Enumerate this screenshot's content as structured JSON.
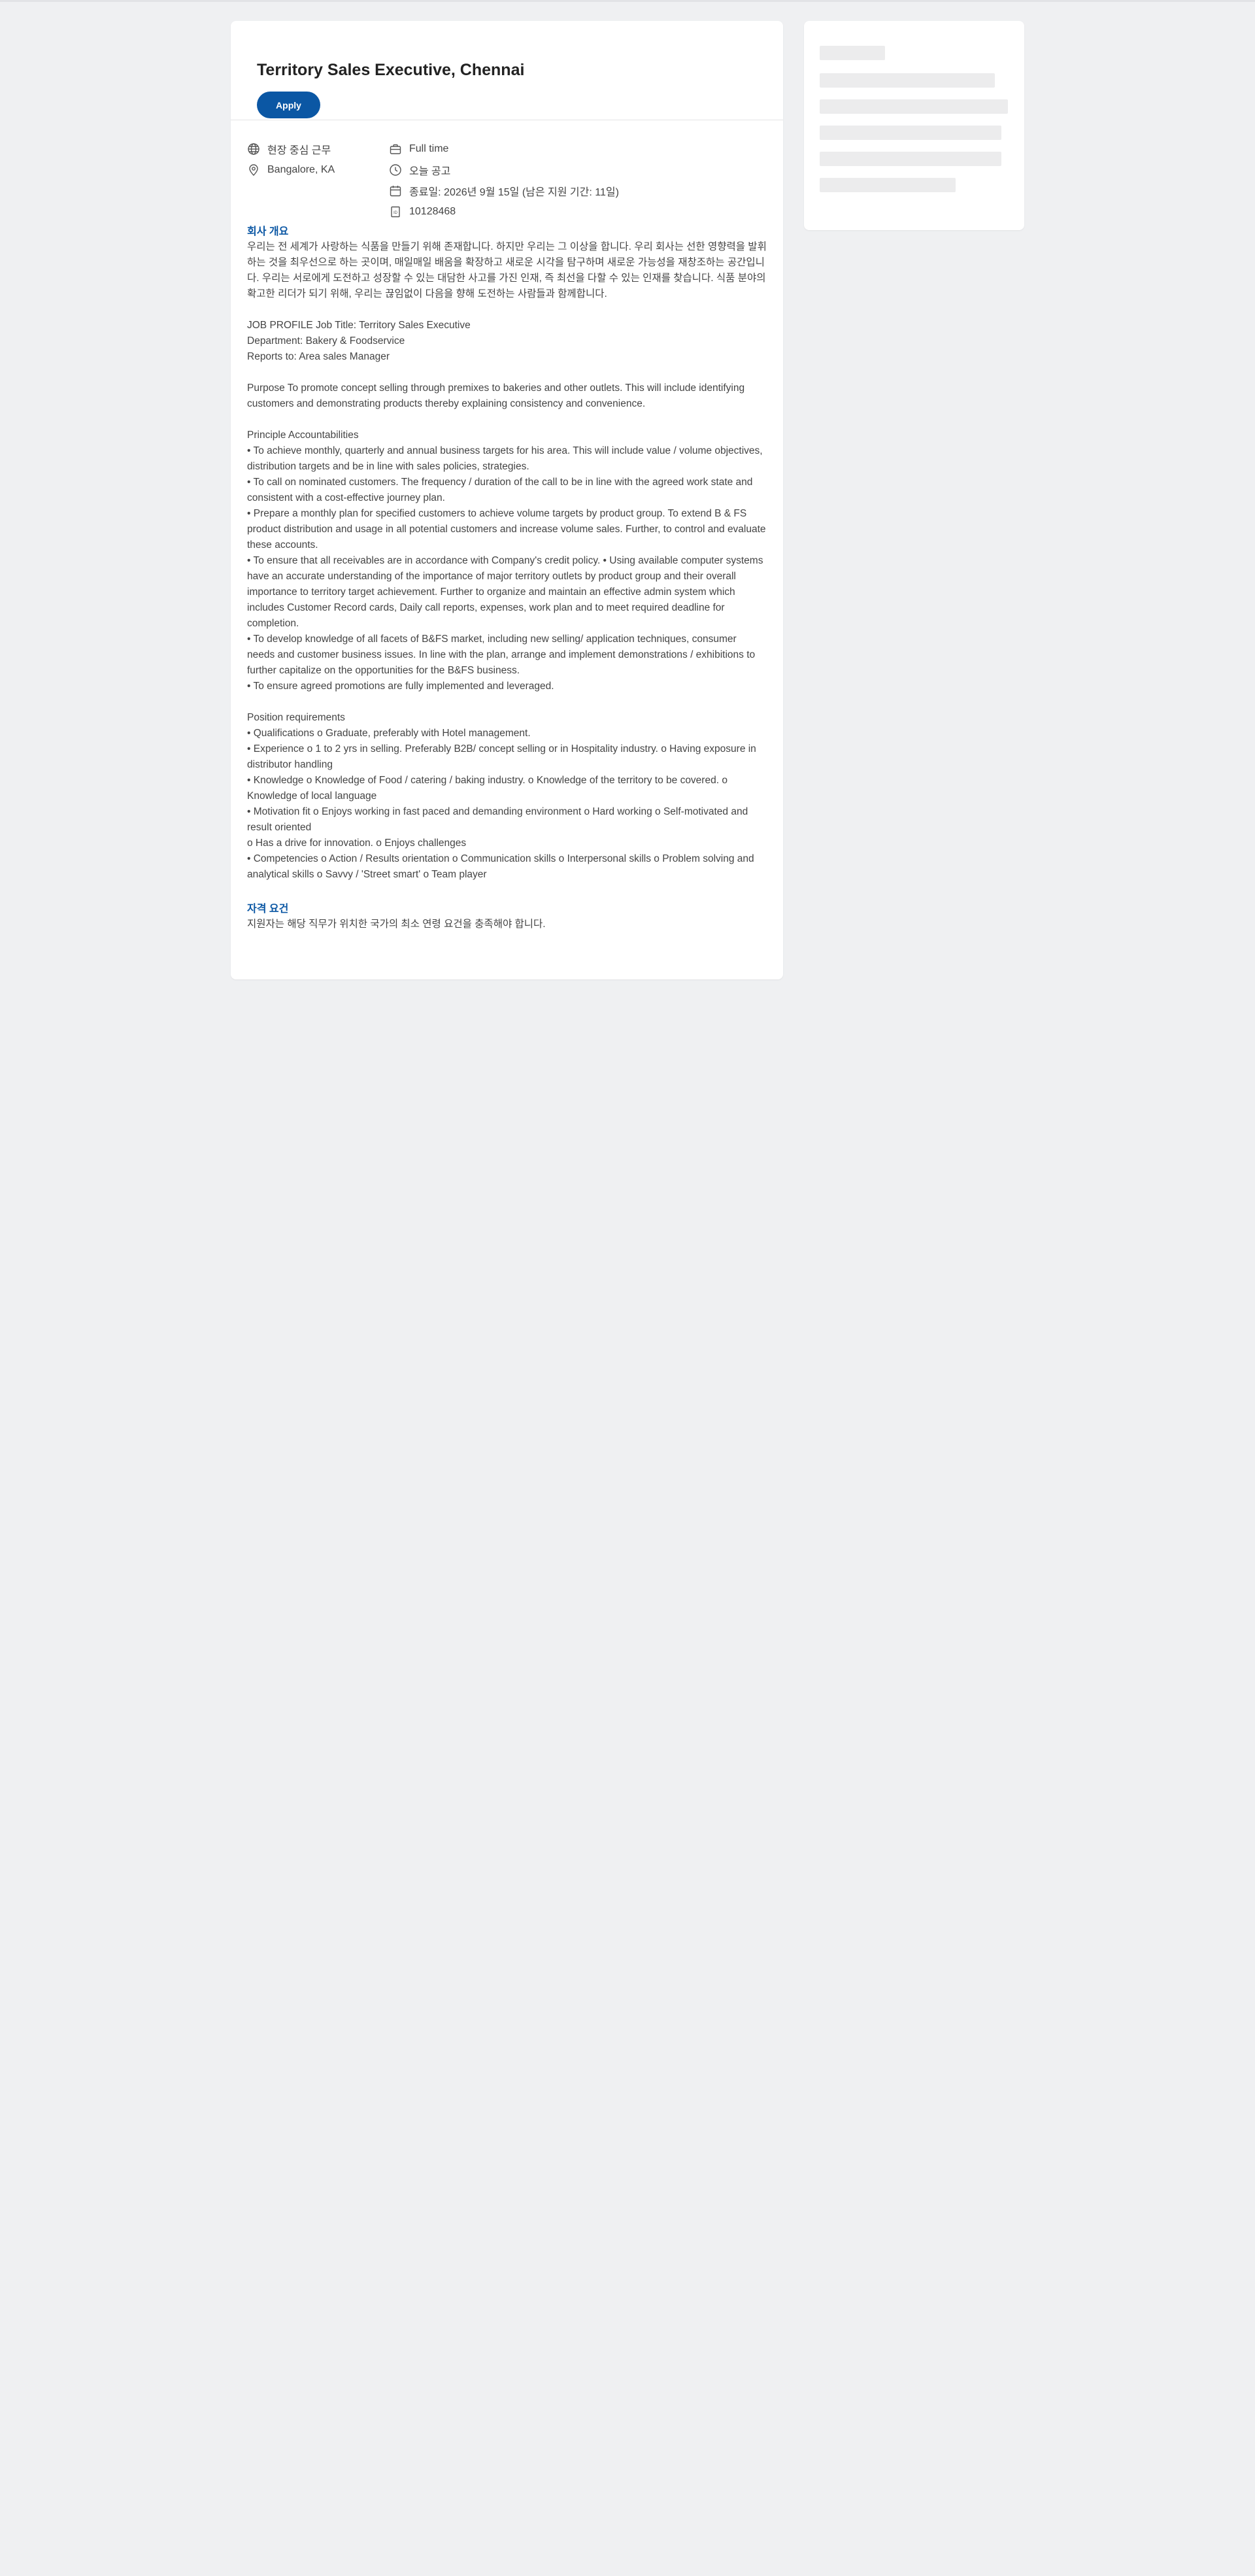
{
  "job": {
    "title": "Territory Sales Executive, Chennai",
    "apply_label": "Apply"
  },
  "meta": {
    "work_type": "현장 중심 근무",
    "location": "Bangalore, KA",
    "employment": "Full time",
    "posted": "오늘 공고",
    "deadline": "종료일: 2026년 9월 15일 (남은 지원 기간: 11일)",
    "job_id": "10128468"
  },
  "icons": {
    "work_type": "globe-icon",
    "location": "location-pin-icon",
    "employment": "briefcase-icon",
    "posted": "clock-icon",
    "deadline": "calendar-icon",
    "job_id": "id-document-icon"
  },
  "about": {
    "heading": "회사 개요",
    "body": "우리는 전 세계가 사랑하는 식품을 만들기 위해 존재합니다. 하지만 우리는 그 이상을 합니다. 우리 회사는 선한 영향력을 발휘하는 것을 최우선으로 하는 곳이며, 매일매일 배움을 확장하고 새로운 시각을 탐구하며 새로운 가능성을 재창조하는 공간입니다. 우리는 서로에게 도전하고 성장할 수 있는 대담한 사고를 가진 인재, 즉 최선을 다할 수 있는 인재를 찾습니다. 식품 분야의 확고한 리더가 되기 위해, 우리는 끊임없이 다음을 향해 도전하는 사람들과 함께합니다."
  },
  "description": {
    "profile": [
      "JOB PROFILE Job Title: Territory Sales Executive",
      "Department: Bakery & Foodservice",
      "Reports to: Area sales Manager"
    ],
    "purpose": "Purpose To promote concept selling through premixes to bakeries and other outlets. This will include identifying customers and demonstrating products thereby explaining consistency and convenience.",
    "accountabilities_title": "Principle Accountabilities",
    "accountabilities": [
      "• To achieve monthly, quarterly and annual business targets for his area. This will include value / volume objectives, distribution targets and be in line with sales policies, strategies.",
      "• To call on nominated customers. The frequency / duration of the call to be in line with the agreed work state and consistent with a cost-effective journey plan.",
      "• Prepare a monthly plan for specified customers to achieve volume targets by product group. To extend B & FS product distribution and usage in all potential customers and increase volume sales. Further, to control and evaluate these accounts.",
      "• To ensure that all receivables are in accordance with Company's credit policy. • Using available computer systems have an accurate understanding of the importance of major territory outlets by product group and their overall importance to territory target achievement. Further to organize and maintain an effective admin system which includes Customer Record cards, Daily call reports, expenses, work plan and to meet required deadline for completion.",
      "• To develop knowledge of all facets of B&FS market, including new selling/ application techniques, consumer needs and customer business issues. In line with the plan, arrange and implement demonstrations / exhibitions to further capitalize on the opportunities for the B&FS business.",
      "• To ensure agreed promotions are fully implemented and leveraged."
    ],
    "requirements_title": "Position requirements",
    "requirements": [
      "• Qualifications o Graduate, preferably with Hotel management.",
      "• Experience o 1 to 2 yrs in selling. Preferably B2B/ concept selling or in Hospitality industry. o Having exposure in distributor handling",
      "• Knowledge o Knowledge of Food / catering / baking industry. o Knowledge of the territory to be covered. o Knowledge of local language",
      "• Motivation fit o Enjoys working in fast paced and demanding environment o Hard working o Self-motivated and result oriented",
      "o Has a drive for innovation. o Enjoys challenges",
      "• Competencies o Action / Results orientation o Communication skills o Interpersonal skills o Problem solving and analytical skills o Savvy / 'Street smart' o Team player"
    ]
  },
  "qualifications": {
    "heading": "자격 요건",
    "body": "지원자는 해당 직무가 위치한 국가의 최소 연령 요건을 충족해야 합니다."
  },
  "colors": {
    "accent": "#0b57a4",
    "page_background": "#eff0f2",
    "card": "#ffffff",
    "skeleton": "#ececed"
  }
}
